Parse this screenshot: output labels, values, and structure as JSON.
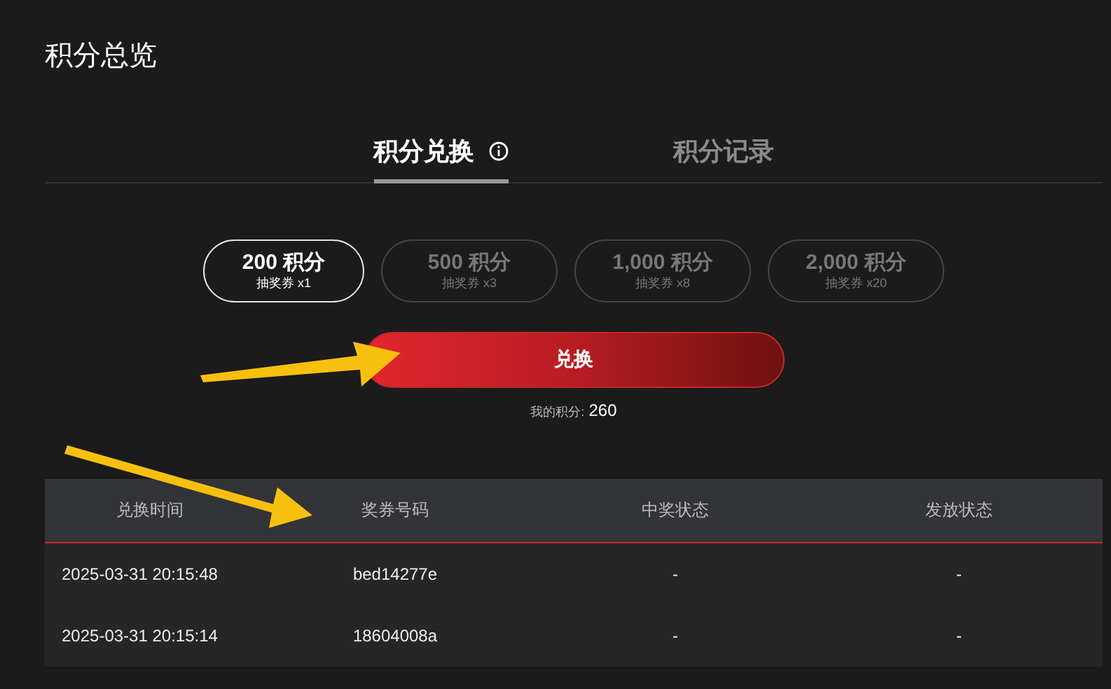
{
  "page": {
    "title": "积分总览"
  },
  "tabs": [
    {
      "label": "积分兑换",
      "selected": true,
      "kind": "info"
    },
    {
      "label": "积分记录",
      "selected": false,
      "kind": "plain"
    }
  ],
  "options": [
    {
      "points": "200 积分",
      "reward": "抽奖券 x1",
      "selected": true
    },
    {
      "points": "500 积分",
      "reward": "抽奖券 x3",
      "selected": false
    },
    {
      "points": "1,000 积分",
      "reward": "抽奖券 x8",
      "selected": false
    },
    {
      "points": "2,000 积分",
      "reward": "抽奖券 x20",
      "selected": false
    }
  ],
  "redeem_button": "兑换",
  "balance": {
    "label": "我的积分:",
    "value": "260"
  },
  "table": {
    "columns": [
      "兑换时间",
      "奖券号码",
      "中奖状态",
      "发放状态"
    ],
    "rows": [
      [
        "2025-03-31 20:15:48",
        "bed14277e",
        "-",
        "-"
      ],
      [
        "2025-03-31 20:15:14",
        "18604008a",
        "-",
        "-"
      ]
    ]
  }
}
